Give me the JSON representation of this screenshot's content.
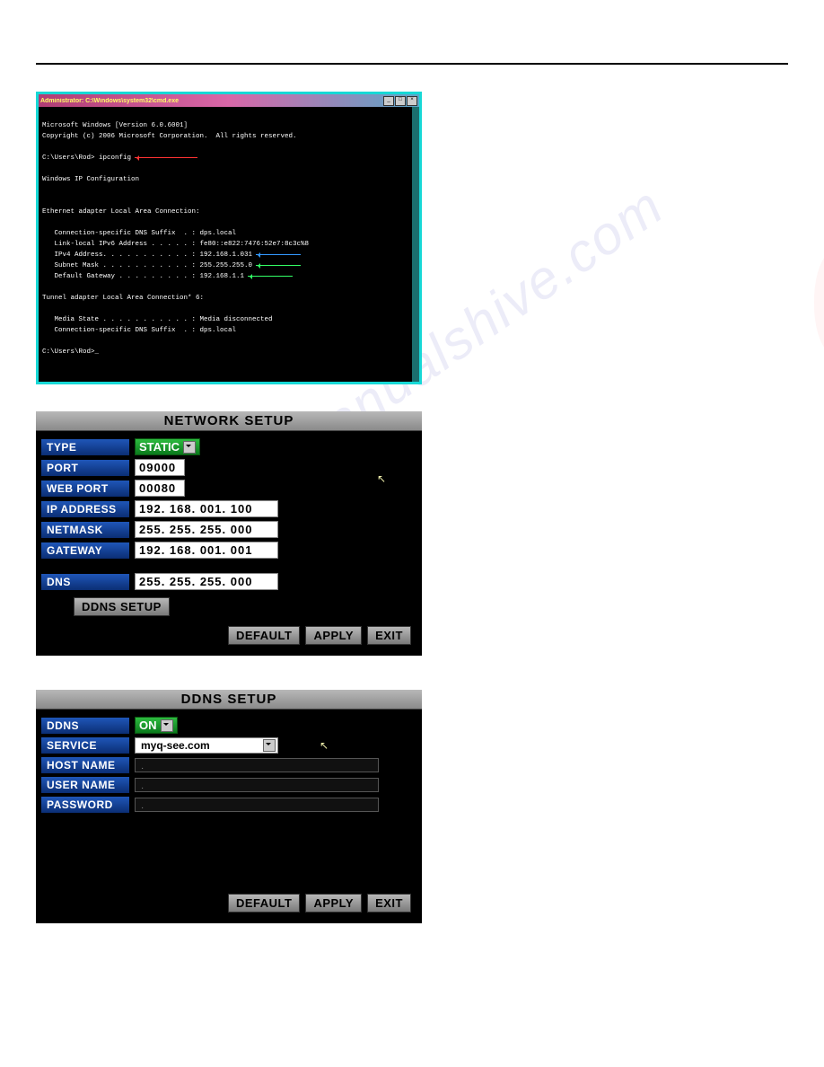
{
  "cmd": {
    "title": "Administrator: C:\\Windows\\system32\\cmd.exe",
    "lines": {
      "l1": "Microsoft Windows [Version 6.0.6001]",
      "l2": "Copyright (c) 2006 Microsoft Corporation.  All rights reserved.",
      "l3": "C:\\Users\\Rod> ipconfig",
      "l4": "Windows IP Configuration",
      "l5": "Ethernet adapter Local Area Connection:",
      "l6": "   Connection-specific DNS Suffix  . : dps.local",
      "l7": "   Link-local IPv6 Address . . . . . : fe80::e822:7476:52e7:8c3c%8",
      "l8": "   IPv4 Address. . . . . . . . . . . : 192.168.1.031",
      "l9": "   Subnet Mask . . . . . . . . . . . : 255.255.255.0",
      "l10": "   Default Gateway . . . . . . . . . : 192.168.1.1",
      "l11": "Tunnel adapter Local Area Connection* 6:",
      "l12": "   Media State . . . . . . . . . . . : Media disconnected",
      "l13": "   Connection-specific DNS Suffix  . : dps.local",
      "l14": "C:\\Users\\Rod>_"
    }
  },
  "network": {
    "header": "NETWORK SETUP",
    "type_label": "TYPE",
    "type_value": "STATIC",
    "port_label": "PORT",
    "port_value": "09000",
    "webport_label": "WEB  PORT",
    "webport_value": "00080",
    "ip_label": "IP ADDRESS",
    "ip_value": "192. 168. 001. 100",
    "netmask_label": "NETMASK",
    "netmask_value": "255. 255. 255. 000",
    "gateway_label": "GATEWAY",
    "gateway_value": "192. 168. 001. 001",
    "dns_label": "DNS",
    "dns_value": "255. 255. 255. 000",
    "ddns_btn": "DDNS SETUP",
    "default_btn": "DEFAULT",
    "apply_btn": "APPLY",
    "exit_btn": "EXIT"
  },
  "ddns": {
    "header": "DDNS SETUP",
    "ddns_label": "DDNS",
    "ddns_value": "ON",
    "service_label": "SERVICE",
    "service_value": "myq-see.com",
    "host_label": "HOST NAME",
    "user_label": "USER NAME",
    "pass_label": "PASSWORD",
    "default_btn": "DEFAULT",
    "apply_btn": "APPLY",
    "exit_btn": "EXIT"
  }
}
